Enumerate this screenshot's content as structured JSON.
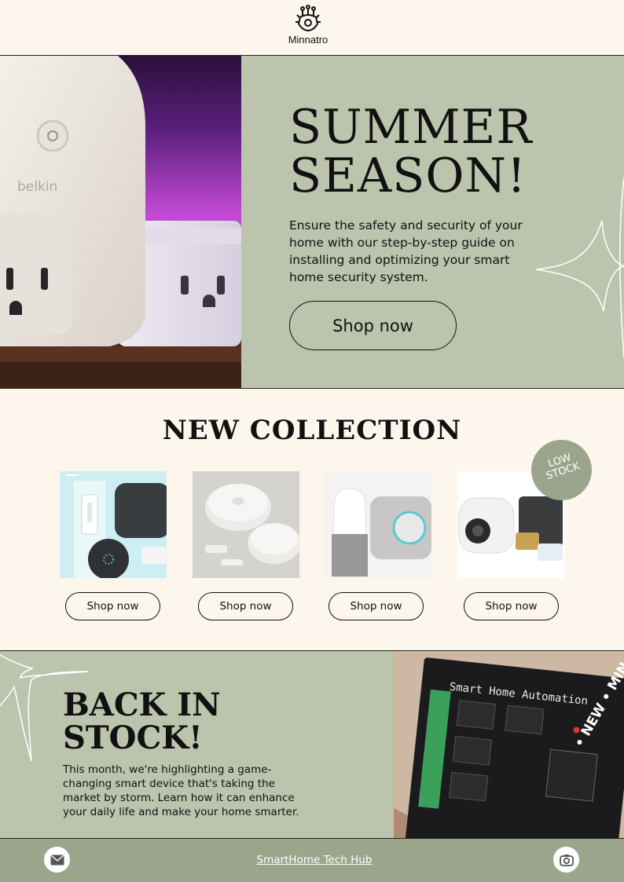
{
  "header": {
    "logo_text": "Minnatro",
    "logo_icon": "circuit-gear-icon"
  },
  "hero": {
    "title_line1": "SUMMER",
    "title_line2": "SEASON!",
    "description": "Ensure the safety and security of your home with our step-by-step guide on installing and optimizing your smart home security system.",
    "button_label": "Shop now",
    "photo_label": "belkin"
  },
  "collection": {
    "title": "NEW COLLECTION",
    "badge_line1": "LOW",
    "badge_line2": "STOCK",
    "products": [
      {
        "button_label": "Shop now"
      },
      {
        "button_label": "Shop now"
      },
      {
        "button_label": "Shop now"
      },
      {
        "button_label": "Shop now"
      }
    ]
  },
  "stock": {
    "title_line1": "BACK IN",
    "title_line2": "STOCK!",
    "description": "This month, we're highlighting a game-changing smart device that's taking the market by storm. Learn how it can enhance your daily life and make your home smarter.",
    "photo_label": "Smart Home Automation",
    "stamp_text": "• NEW • MIN •"
  },
  "footer": {
    "link_text": "SmartHome Tech Hub",
    "email_icon": "mail-icon",
    "camera_icon": "camera-icon"
  },
  "colors": {
    "sage": "#bcc4ad",
    "cream": "#fdf6ec",
    "footer_green": "#9aa58b"
  }
}
